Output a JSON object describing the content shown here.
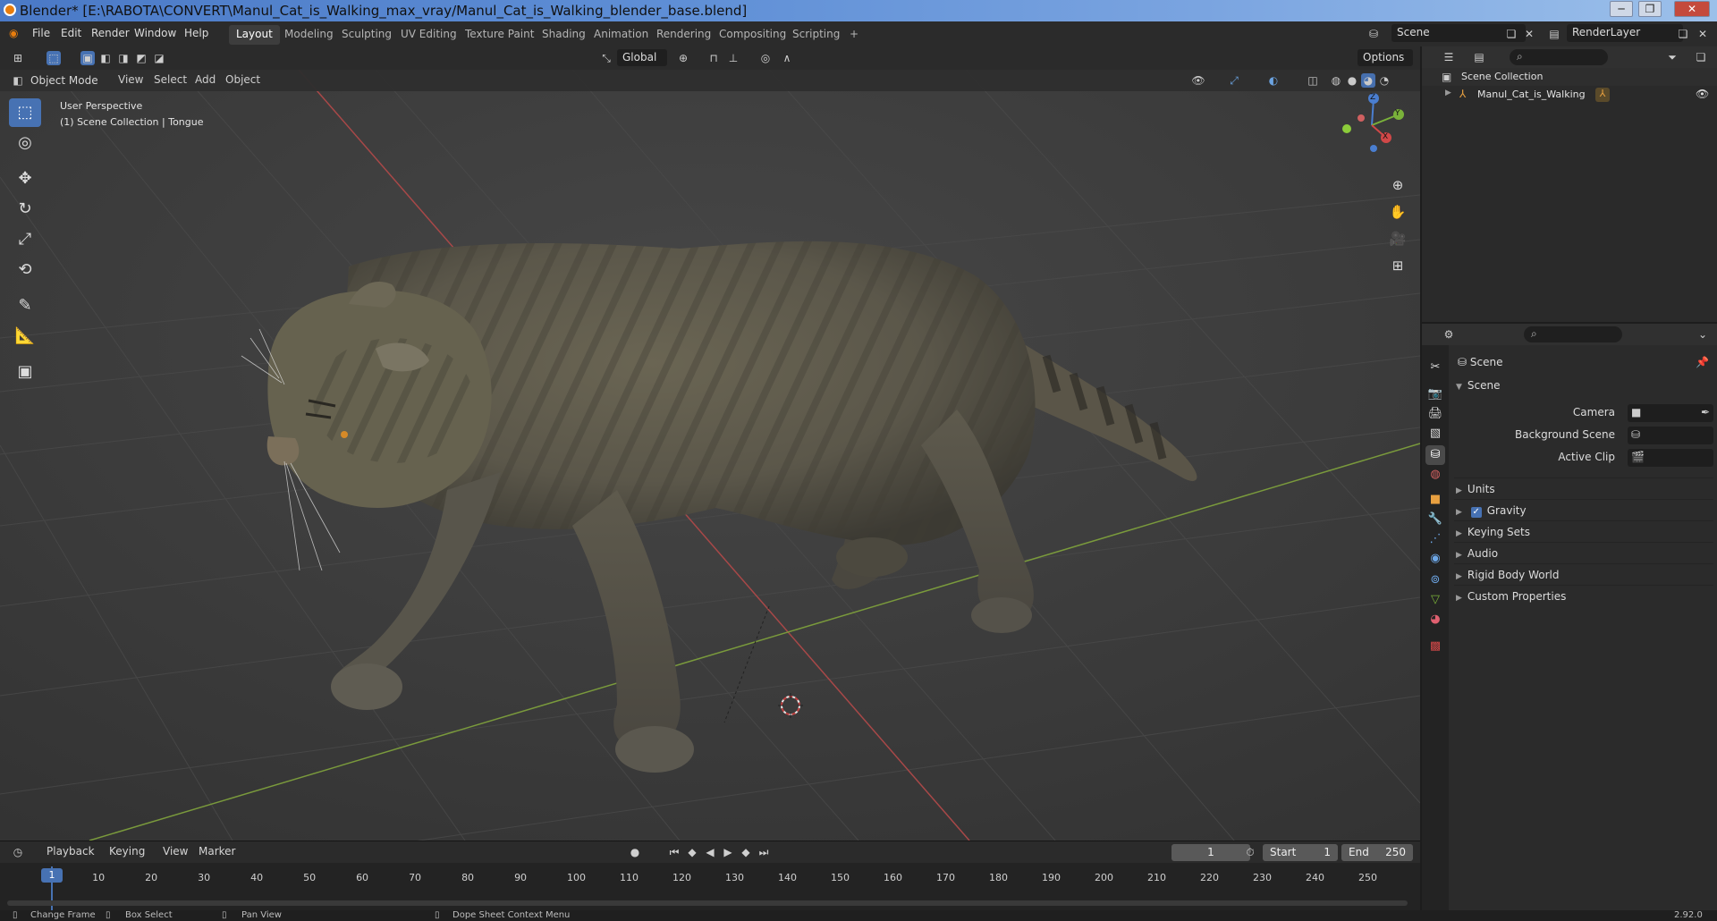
{
  "window": {
    "title": "Blender* [E:\\RABOTA\\CONVERT\\Manul_Cat_is_Walking_max_vray/Manul_Cat_is_Walking_blender_base.blend]",
    "min_symbol": "─",
    "max_symbol": "❐",
    "close_symbol": "✕"
  },
  "menu": {
    "items": [
      "File",
      "Edit",
      "Render",
      "Window",
      "Help"
    ],
    "workspaces": [
      "Layout",
      "Modeling",
      "Sculpting",
      "UV Editing",
      "Texture Paint",
      "Shading",
      "Animation",
      "Rendering",
      "Compositing",
      "Scripting"
    ],
    "active_workspace": "Layout",
    "add_tab": "+",
    "scene_name": "Scene",
    "render_layer": "RenderLayer"
  },
  "viewport_header": {
    "transform_orientation": "Global",
    "options_label": "Options",
    "mode": "Object Mode",
    "menus": [
      "View",
      "Select",
      "Add",
      "Object"
    ]
  },
  "viewport": {
    "perspective_label": "User Perspective",
    "collection_label": "(1) Scene Collection | Tongue",
    "gizmo": {
      "z": "Z",
      "y": "Y",
      "x": "X"
    },
    "colors": {
      "x_axis": "#a84848",
      "y_axis": "#7a9a3c",
      "grid": "#474747",
      "bg": "#3d3d3d"
    }
  },
  "timeline": {
    "menus": [
      "Playback",
      "Keying",
      "View",
      "Marker"
    ],
    "current_frame": "1",
    "start_label": "Start",
    "start_value": "1",
    "end_label": "End",
    "end_value": "250",
    "ruler": [
      "1",
      "10",
      "20",
      "30",
      "40",
      "50",
      "60",
      "70",
      "80",
      "90",
      "100",
      "110",
      "120",
      "130",
      "140",
      "150",
      "160",
      "170",
      "180",
      "190",
      "200",
      "210",
      "220",
      "230",
      "240",
      "250"
    ]
  },
  "statusbar": {
    "items": [
      "Change Frame",
      "Box Select",
      "Pan View",
      "Dope Sheet Context Menu"
    ],
    "version": "2.92.0"
  },
  "outliner": {
    "root": "Scene Collection",
    "items": [
      "Manul_Cat_is_Walking"
    ]
  },
  "properties": {
    "context": "Scene",
    "panel": "Scene",
    "fields": {
      "camera_label": "Camera",
      "background_scene_label": "Background Scene",
      "active_clip_label": "Active Clip"
    },
    "panels": [
      "Units",
      "Gravity",
      "Keying Sets",
      "Audio",
      "Rigid Body World",
      "Custom Properties"
    ],
    "gravity_checked": true
  }
}
